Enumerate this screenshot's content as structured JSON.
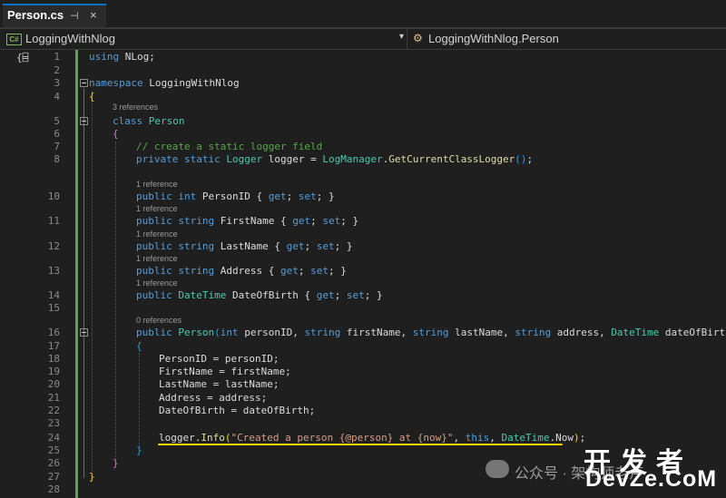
{
  "tab": {
    "title": "Person.cs",
    "pin_glyph": "⊣",
    "close_glyph": "×"
  },
  "navbar": {
    "project_icon_label": "C#",
    "project": "LoggingWithNlog",
    "dropdown_glyph": "▾",
    "class_icon_glyph": "⚙",
    "class": "LoggingWithNlog.Person"
  },
  "gutter_icon_glyph": "{⌸",
  "line_numbers": [
    "1",
    "2",
    "3",
    "4",
    "5",
    "6",
    "7",
    "8",
    "10",
    "11",
    "12",
    "13",
    "14",
    "15",
    "16",
    "17",
    "18",
    "19",
    "20",
    "21",
    "22",
    "23",
    "24",
    "25",
    "26",
    "27",
    "28"
  ],
  "references": [
    "3 references",
    "1 reference",
    "1 reference",
    "1 reference",
    "1 reference",
    "1 reference",
    "0 references"
  ],
  "code": {
    "l1": {
      "kw": "using",
      "name": "NLog",
      "semi": ";"
    },
    "l3": {
      "kw": "namespace",
      "name": "LoggingWithNlog"
    },
    "l4": {
      "brace": "{"
    },
    "l5": {
      "kw": "class",
      "name": "Person"
    },
    "l6": {
      "brace": "{"
    },
    "l7": {
      "comment": "// create a static logger field"
    },
    "l8": {
      "kw1": "private",
      "kw2": "static",
      "type": "Logger",
      "name": "logger",
      "eq": " = ",
      "cls": "LogManager",
      "dot": ".",
      "mth": "GetCurrentClassLogger",
      "paren": "()",
      "semi": ";"
    },
    "l10": {
      "kw1": "public",
      "type": "int",
      "name": "PersonID",
      "ob": "{",
      "get": "get",
      "s1": ";",
      "set": "set",
      "s2": ";",
      "cb": "}"
    },
    "l11": {
      "kw1": "public",
      "type": "string",
      "name": "FirstName",
      "ob": "{",
      "get": "get",
      "s1": ";",
      "set": "set",
      "s2": ";",
      "cb": "}"
    },
    "l12": {
      "kw1": "public",
      "type": "string",
      "name": "LastName",
      "ob": "{",
      "get": "get",
      "s1": ";",
      "set": "set",
      "s2": ";",
      "cb": "}"
    },
    "l13": {
      "kw1": "public",
      "type": "string",
      "name": "Address",
      "ob": "{",
      "get": "get",
      "s1": ";",
      "set": "set",
      "s2": ";",
      "cb": "}"
    },
    "l14": {
      "kw1": "public",
      "type": "DateTime",
      "name": "DateOfBirth",
      "ob": "{",
      "get": "get",
      "s1": ";",
      "set": "set",
      "s2": ";",
      "cb": "}"
    },
    "l16": {
      "kw1": "public",
      "name": "Person",
      "op": "(",
      "t1": "int",
      "p1": "personID",
      "c1": ", ",
      "t2": "string",
      "p2": "firstName",
      "c2": ", ",
      "t3": "string",
      "p3": "lastName",
      "c3": ", ",
      "t4": "string",
      "p4": "address",
      "c4": ", ",
      "t5": "DateTime",
      "p5": "dateOfBirth",
      "cp": ")"
    },
    "l17": {
      "brace": "{"
    },
    "l18": {
      "lhs": "PersonID",
      "eq": " = ",
      "rhs": "personID",
      "semi": ";"
    },
    "l19": {
      "lhs": "FirstName",
      "eq": " = ",
      "rhs": "firstName",
      "semi": ";"
    },
    "l20": {
      "lhs": "LastName",
      "eq": " = ",
      "rhs": "lastName",
      "semi": ";"
    },
    "l21": {
      "lhs": "Address",
      "eq": " = ",
      "rhs": "address",
      "semi": ";"
    },
    "l22": {
      "lhs": "DateOfBirth",
      "eq": " = ",
      "rhs": "dateOfBirth",
      "semi": ";"
    },
    "l24": {
      "obj": "logger",
      "dot": ".",
      "mth": "Info",
      "op": "(",
      "str": "\"Created a person {@person} at {now}\"",
      "c1": ", ",
      "this": "this",
      "c2": ", ",
      "cls": "DateTime",
      "dot2": ".",
      "prop": "Now",
      "cp": ")",
      "semi": ";"
    },
    "l25": {
      "brace": "}"
    },
    "l26": {
      "brace": "}"
    },
    "l27": {
      "brace": "}"
    }
  },
  "watermark": {
    "text": "公众号 · 架构师老卢",
    "cn": "开发者",
    "en": "DevZe.CoM"
  },
  "colors": {
    "keyword": "#569cd6",
    "type": "#4ec9b0",
    "comment": "#57a64a",
    "string": "#d69d85",
    "method": "#dcdcaa",
    "highlight": "#ffd600"
  }
}
